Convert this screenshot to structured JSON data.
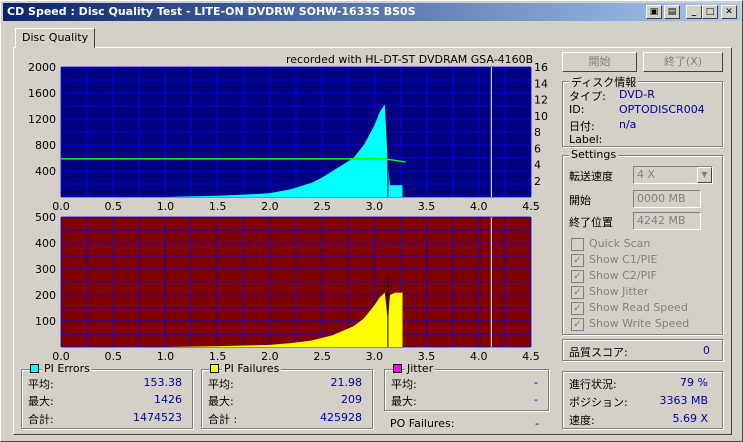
{
  "window": {
    "title": "CD Speed : Disc Quality Test - LITE-ON DVDRW SOHW-1633S BS0S"
  },
  "tab": {
    "label": "Disc Quality"
  },
  "recorded_text": "recorded with HL-DT-ST DVDRAM GSA-4160B",
  "buttons": {
    "start": "開始",
    "exit": "終了(X)"
  },
  "disc_info": {
    "title": "ディスク情報",
    "type_label": "タイプ:",
    "type_value": "DVD-R",
    "id_label": "ID:",
    "id_value": "OPTODISCR004",
    "date_label": "日付:",
    "date_value": "n/a",
    "label_label": "Label:"
  },
  "settings": {
    "title": "Settings",
    "speed_label": "転送速度",
    "speed_value": "4 X",
    "start_label": "開始",
    "start_value": "0000 MB",
    "end_label": "終了位置",
    "end_value": "4242 MB",
    "quick_scan": "Quick Scan",
    "show_c1": "Show C1/PIE",
    "show_c2": "Show C2/PIF",
    "show_jitter": "Show Jitter",
    "show_read": "Show Read Speed",
    "show_write": "Show Write Speed"
  },
  "score": {
    "label": "品質スコア:",
    "value": "0"
  },
  "progress": {
    "status_label": "進行状況:",
    "status_value": "79 %",
    "position_label": "ポジション:",
    "position_value": "3363 MB",
    "speed_label": "速度:",
    "speed_value": "5.69 X"
  },
  "pi_errors": {
    "title": "PI Errors",
    "avg_label": "平均:",
    "avg": "153.38",
    "max_label": "最大:",
    "max": "1426",
    "total_label": "合計:",
    "total": "1474523",
    "color": "#00ffff"
  },
  "pi_failures": {
    "title": "PI Failures",
    "avg_label": "平均:",
    "avg": "21.98",
    "max_label": "最大:",
    "max": "209",
    "total_label": "合計 :",
    "total": "425928",
    "color": "#ffff00"
  },
  "jitter": {
    "title": "Jitter",
    "avg_label": "平均:",
    "avg": "-",
    "max_label": "最大:",
    "max": "-",
    "color": "#ff00ff"
  },
  "po_failures": {
    "label": "PO Failures:",
    "value": "-"
  },
  "chart_data": [
    {
      "type": "area",
      "series": [
        {
          "name": "PI Errors",
          "color": "#00ffff"
        },
        {
          "name": "Read Speed",
          "color": "#00ff00"
        }
      ],
      "xlim": [
        0,
        4.5
      ],
      "ylim": [
        0,
        2000
      ],
      "y2lim": [
        0,
        16
      ],
      "x_ticks": [
        "0.0",
        "0.5",
        "1.0",
        "1.5",
        "2.0",
        "2.5",
        "3.0",
        "3.5",
        "4.0",
        "4.5"
      ],
      "y_ticks": [
        "2000",
        "1600",
        "1200",
        "800",
        "400"
      ],
      "y2_ticks": [
        "16",
        "14",
        "12",
        "10",
        "8",
        "6",
        "4",
        "2"
      ],
      "pie_x": [
        0,
        1.0,
        1.5,
        1.8,
        2.0,
        2.2,
        2.4,
        2.5,
        2.6,
        2.7,
        2.8,
        2.9,
        3.0,
        3.05,
        3.1,
        3.13,
        3.15,
        3.2,
        3.27
      ],
      "pie_y": [
        0,
        0,
        20,
        40,
        60,
        120,
        220,
        300,
        400,
        500,
        600,
        800,
        1100,
        1300,
        1426,
        500,
        180,
        180,
        180
      ],
      "speed_x": [
        0,
        0.5,
        1.0,
        1.5,
        2.0,
        2.5,
        3.0,
        3.1,
        3.2,
        3.3
      ],
      "speed_y": [
        4.7,
        4.7,
        4.7,
        4.7,
        4.7,
        4.7,
        4.7,
        4.7,
        4.5,
        4.3
      ],
      "bg": "#000080",
      "grid": true
    },
    {
      "type": "area",
      "series": [
        {
          "name": "PI Failures",
          "color": "#ffff00"
        }
      ],
      "xlim": [
        0,
        4.5
      ],
      "ylim": [
        0,
        500
      ],
      "x_ticks": [
        "0.0",
        "0.5",
        "1.0",
        "1.5",
        "2.0",
        "2.5",
        "3.0",
        "3.5",
        "4.0",
        "4.5"
      ],
      "y_ticks": [
        "500",
        "400",
        "300",
        "200",
        "100"
      ],
      "pif_x": [
        0,
        1.0,
        1.5,
        2.0,
        2.2,
        2.4,
        2.6,
        2.8,
        2.9,
        3.0,
        3.05,
        3.1,
        3.13,
        3.15,
        3.2,
        3.27
      ],
      "pif_y": [
        0,
        0,
        3,
        8,
        15,
        25,
        45,
        80,
        110,
        160,
        190,
        209,
        100,
        200,
        209,
        209
      ],
      "bg": "#800000",
      "grid": true
    }
  ]
}
